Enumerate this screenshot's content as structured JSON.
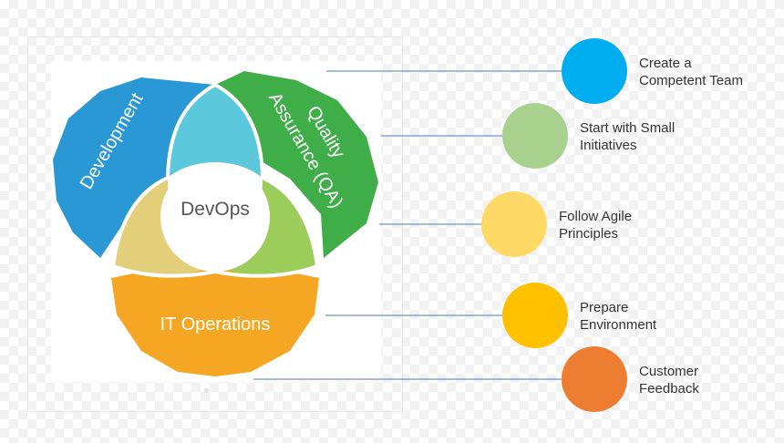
{
  "diagram": {
    "center": "DevOps",
    "development": "Development",
    "qa_line1": "Quality",
    "qa_line2": "Assurance (QA)",
    "it_operations": "IT Operations"
  },
  "steps": [
    {
      "line1": "Create a",
      "line2": "Competent Team",
      "color": "#00aeef"
    },
    {
      "line1": "Start with Small",
      "line2": "Initiatives",
      "color": "#a9d18e"
    },
    {
      "line1": "Follow Agile",
      "line2": "Principles",
      "color": "#ffd966"
    },
    {
      "line1": "Prepare",
      "line2": "Environment",
      "color": "#ffc000"
    },
    {
      "line1": "Customer",
      "line2": "Feedback",
      "color": "#ed7d31"
    }
  ],
  "colors": {
    "development": "#2a98d5",
    "qa": "#3fae49",
    "it_operations": "#f5a623",
    "overlap_top": "#5bc8dc",
    "overlap_left": "#e3cf7a",
    "overlap_right": "#9ccd5a",
    "connector": "#4a79c4"
  }
}
